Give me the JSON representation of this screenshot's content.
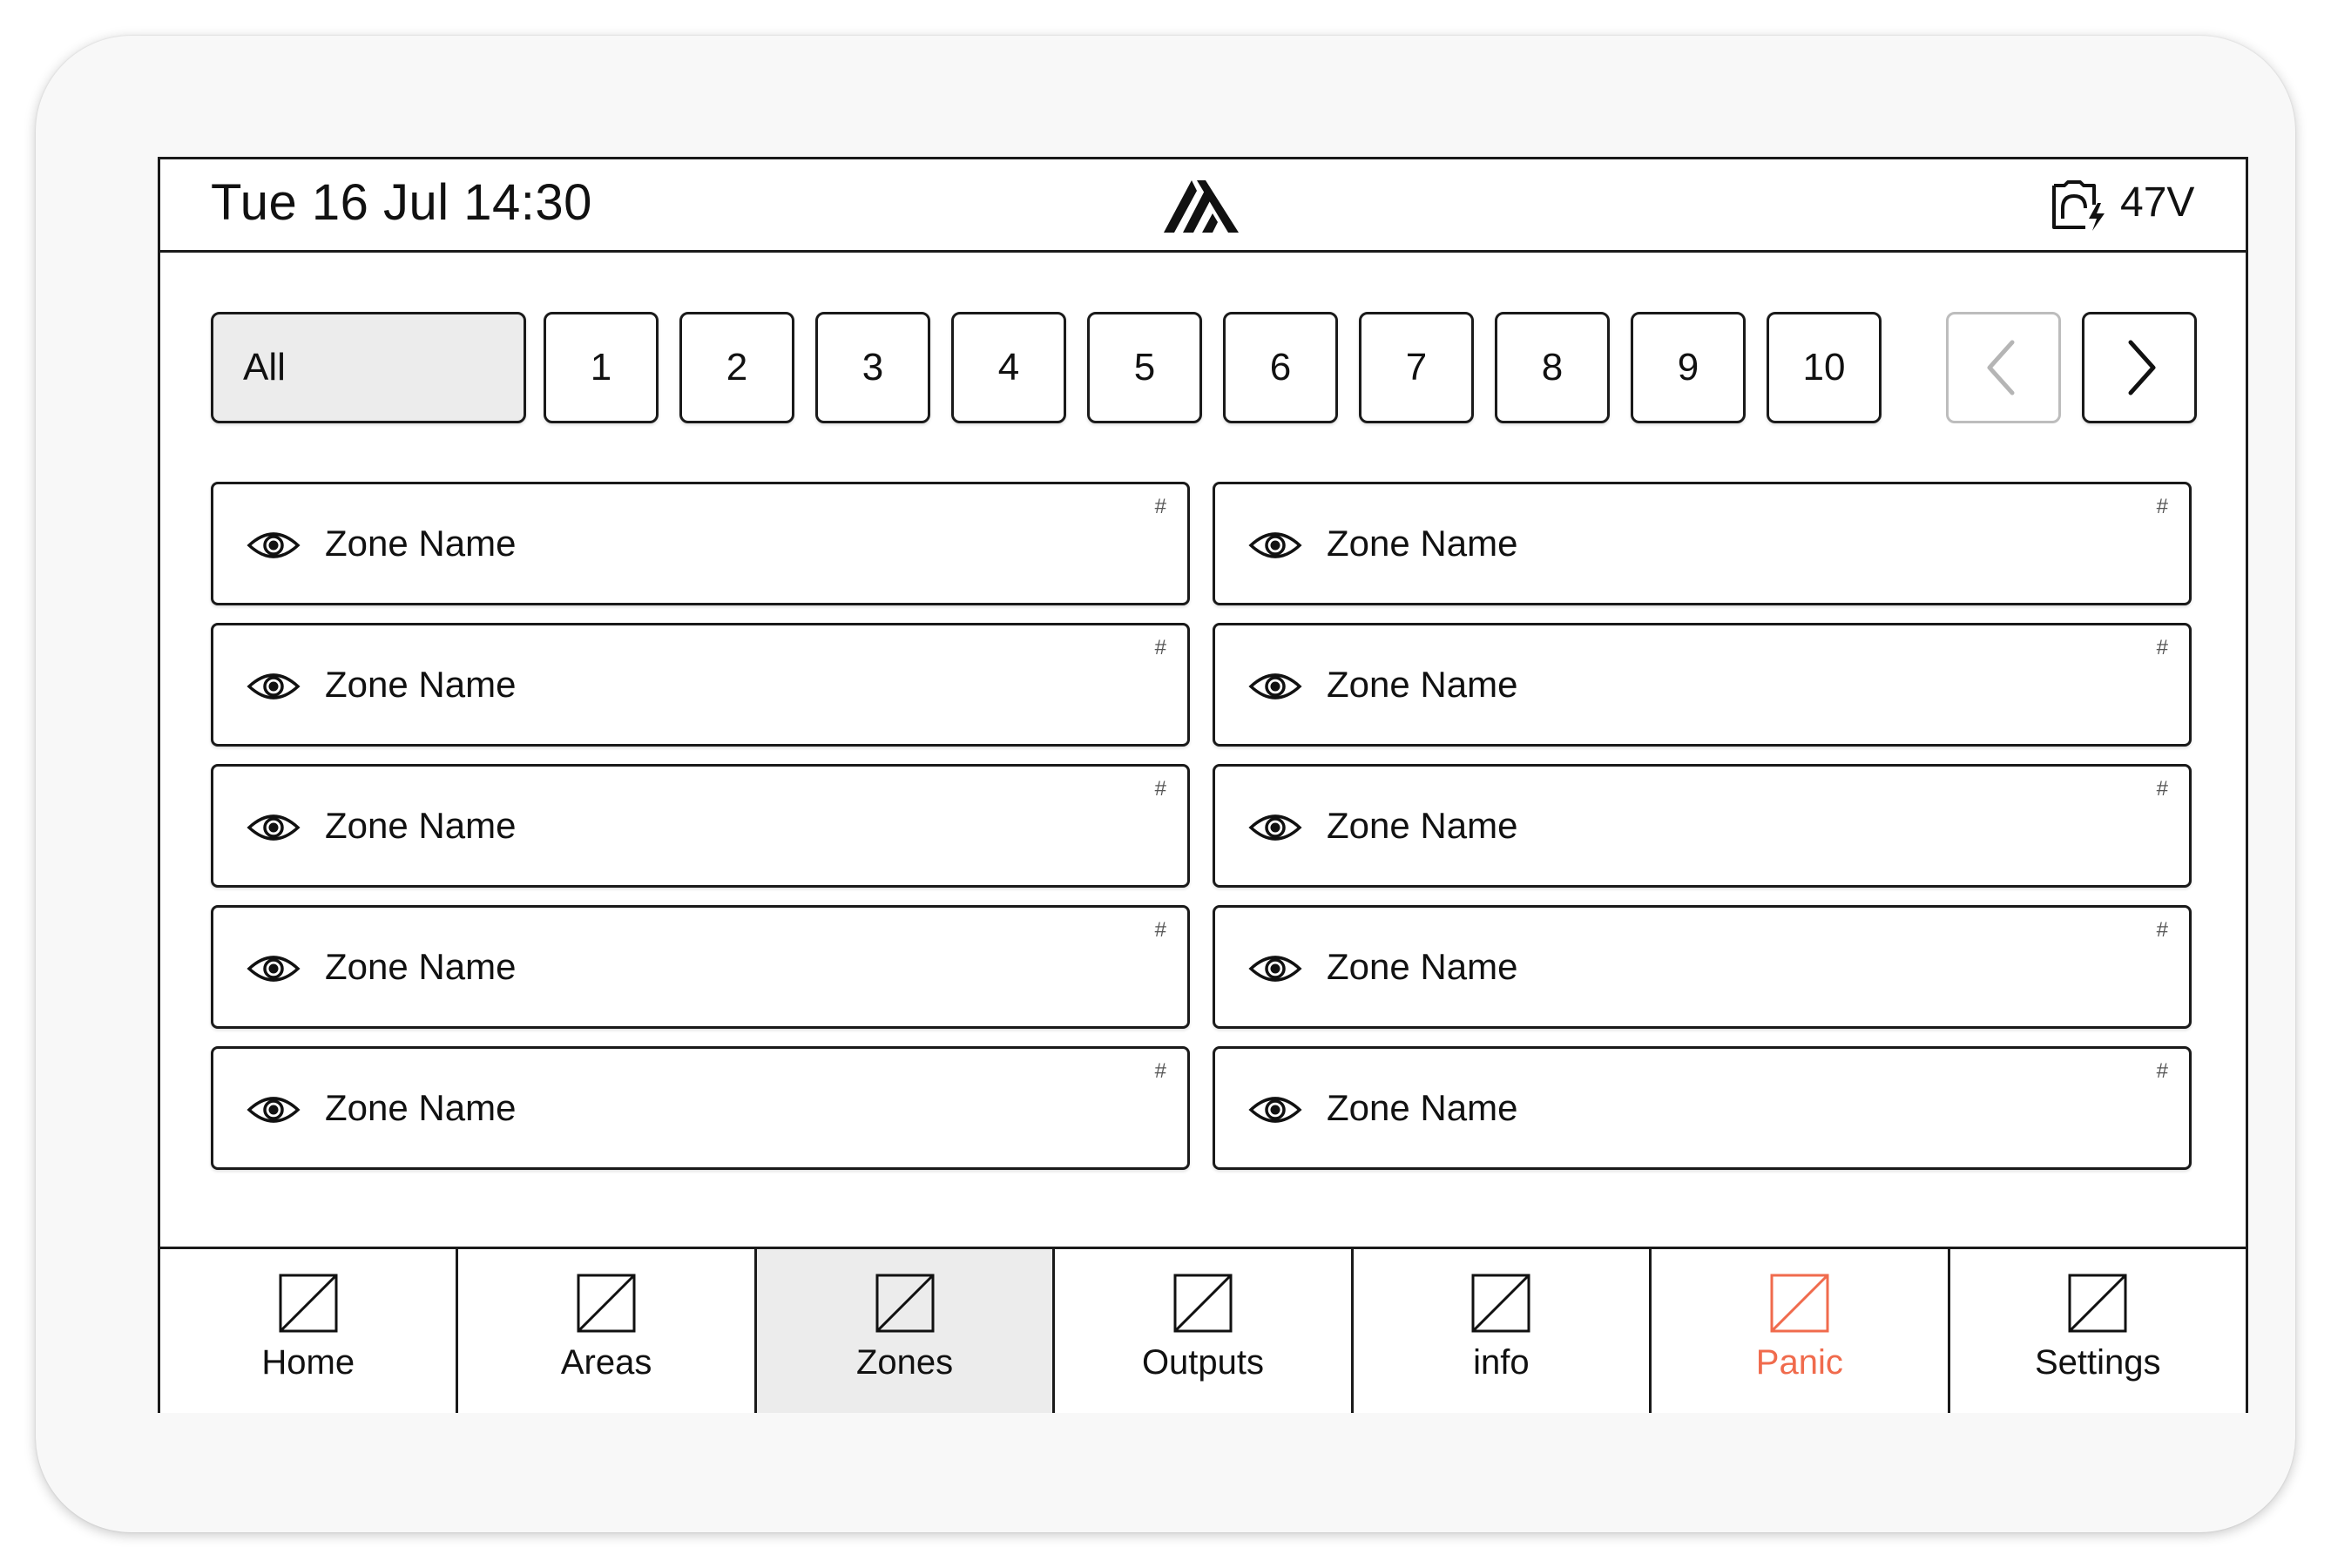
{
  "header": {
    "datetime": "Tue 16 Jul 14:30",
    "logo_icon": "brand-logo",
    "power_icon": "mains-power-icon",
    "voltage": "47V"
  },
  "pager": {
    "all_label": "All",
    "pages": [
      "1",
      "2",
      "3",
      "4",
      "5",
      "6",
      "7",
      "8",
      "9",
      "10"
    ],
    "prev_icon": "chevron-left-icon",
    "next_icon": "chevron-right-icon",
    "prev_disabled": true
  },
  "zones": [
    {
      "name": "Zone Name",
      "number": "#",
      "icon": "eye-icon"
    },
    {
      "name": "Zone Name",
      "number": "#",
      "icon": "eye-icon"
    },
    {
      "name": "Zone Name",
      "number": "#",
      "icon": "eye-icon"
    },
    {
      "name": "Zone Name",
      "number": "#",
      "icon": "eye-icon"
    },
    {
      "name": "Zone Name",
      "number": "#",
      "icon": "eye-icon"
    },
    {
      "name": "Zone Name",
      "number": "#",
      "icon": "eye-icon"
    },
    {
      "name": "Zone Name",
      "number": "#",
      "icon": "eye-icon"
    },
    {
      "name": "Zone Name",
      "number": "#",
      "icon": "eye-icon"
    },
    {
      "name": "Zone Name",
      "number": "#",
      "icon": "eye-icon"
    },
    {
      "name": "Zone Name",
      "number": "#",
      "icon": "eye-icon"
    }
  ],
  "nav": {
    "items": [
      {
        "label": "Home",
        "icon": "placeholder-icon"
      },
      {
        "label": "Areas",
        "icon": "placeholder-icon"
      },
      {
        "label": "Zones",
        "icon": "placeholder-icon",
        "active": true
      },
      {
        "label": "Outputs",
        "icon": "placeholder-icon"
      },
      {
        "label": "info",
        "icon": "placeholder-icon"
      },
      {
        "label": "Panic",
        "icon": "placeholder-icon",
        "accent": "#f06b4d"
      },
      {
        "label": "Settings",
        "icon": "placeholder-icon"
      }
    ]
  },
  "colors": {
    "accent": "#f06b4d",
    "active_bg": "#ececec",
    "border": "#1a1a1a"
  }
}
